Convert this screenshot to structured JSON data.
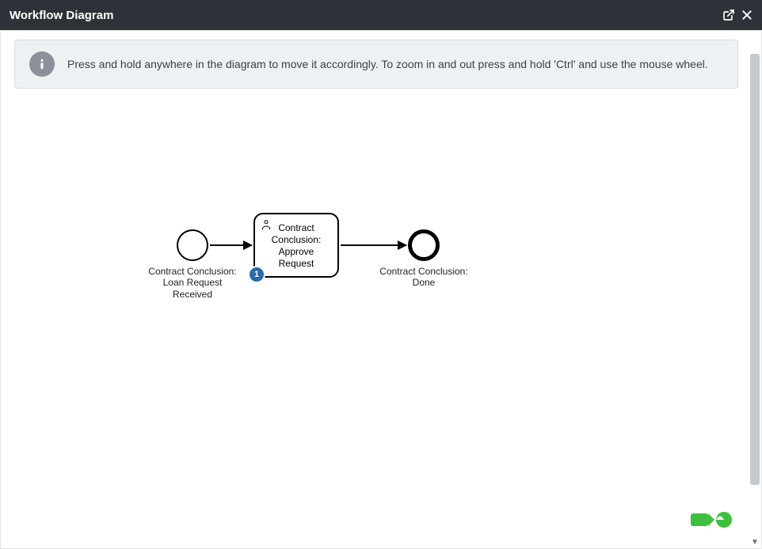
{
  "header": {
    "title": "Workflow Diagram"
  },
  "info": {
    "text": "Press and hold anywhere in the diagram to move it accordingly. To zoom in and out press and hold 'Ctrl' and use the mouse wheel."
  },
  "diagram": {
    "start": {
      "label": "Contract Conclusion: Loan Request Received"
    },
    "task": {
      "label": "Contract Conclusion: Approve Request",
      "badge": "1"
    },
    "end": {
      "label": "Contract Conclusion: Done"
    }
  }
}
